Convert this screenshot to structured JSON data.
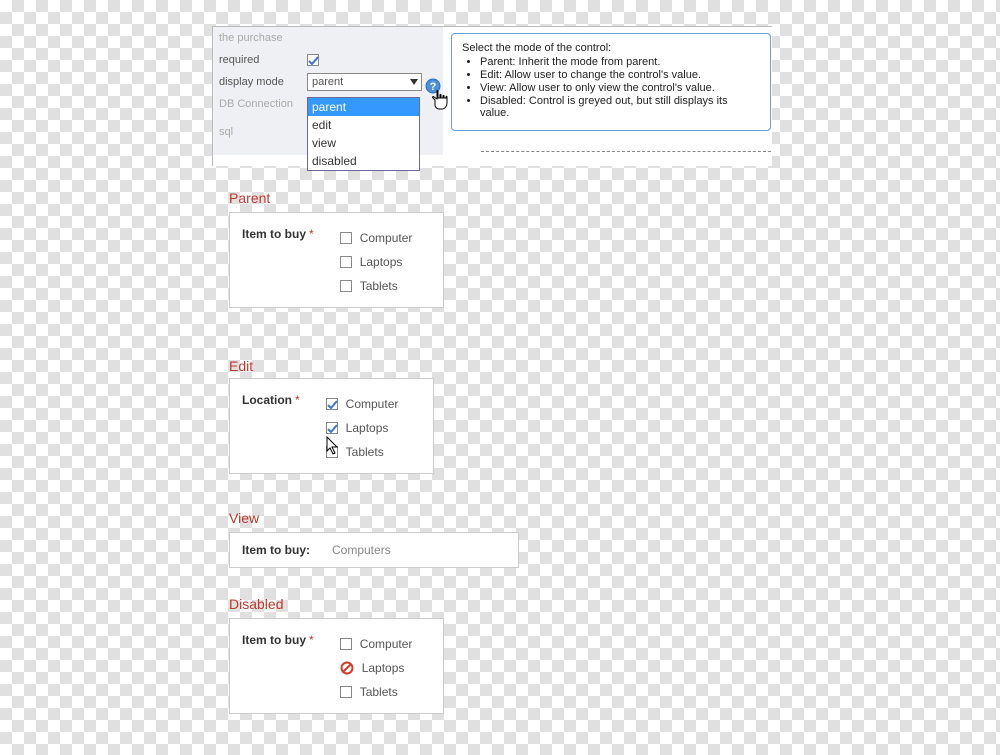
{
  "props": {
    "row0_label": "the purchase",
    "row_required_label": "required",
    "row_displaymode_label": "display mode",
    "row_db_label": "DB Connection",
    "row_sql_label": "sql",
    "dropdown_value": "parent",
    "options": [
      "parent",
      "edit",
      "view",
      "disabled"
    ]
  },
  "tooltip": {
    "intro": "Select the mode of the control:",
    "items": [
      "Parent: Inherit the mode from parent.",
      "Edit: Allow user to change the control's value.",
      "View: Allow user to only view the control's value.",
      "Disabled: Control is greyed out, but still displays its value."
    ]
  },
  "parent_section": {
    "title": "Parent",
    "field_label": "Item to buy",
    "options": [
      "Computer",
      "Laptops",
      "Tablets"
    ]
  },
  "edit_section": {
    "title": "Edit",
    "field_label": "Location",
    "options": [
      "Computer",
      "Laptops",
      "Tablets"
    ]
  },
  "view_section": {
    "title": "View",
    "field_label": "Item to buy:",
    "value": "Computers"
  },
  "disabled_section": {
    "title": "Disabled",
    "field_label": "Item to buy",
    "options": [
      "Computer",
      "Laptops",
      "Tablets"
    ]
  }
}
